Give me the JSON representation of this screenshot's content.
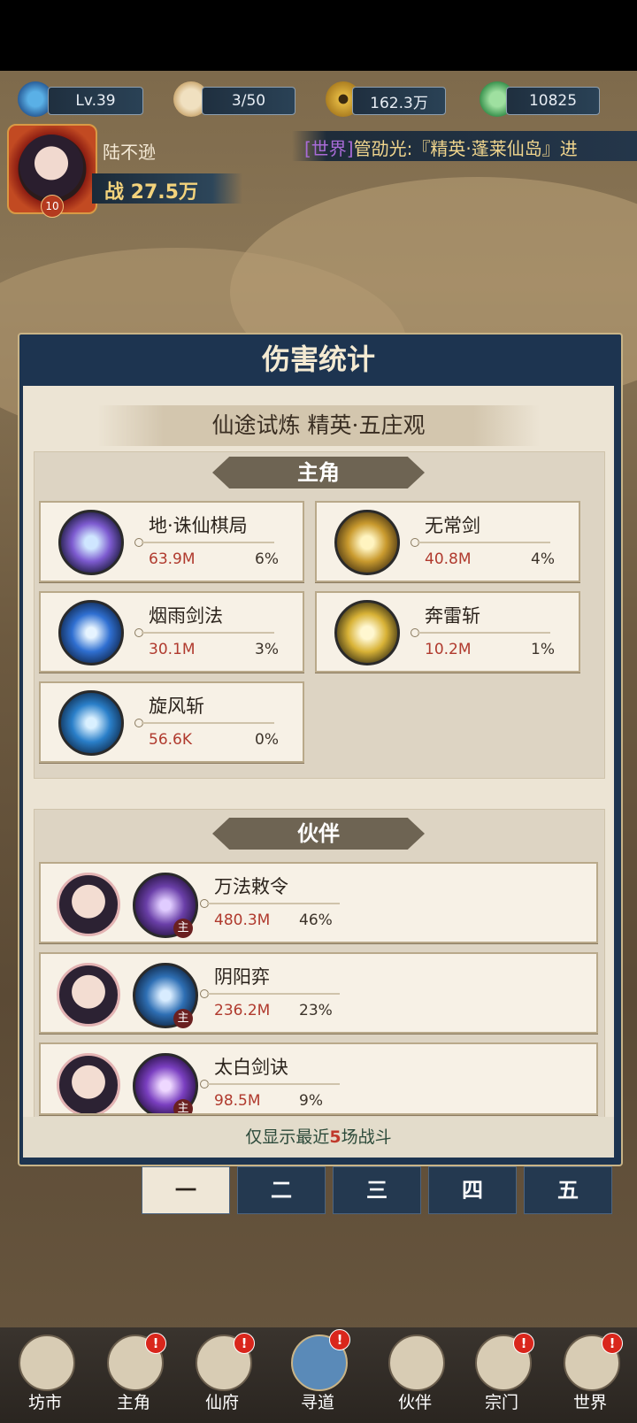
{
  "hud": {
    "level": "Lv.39",
    "stamina": "3/50",
    "coins": "162.3万",
    "jade": "10825",
    "player_name": "陆不逊",
    "power": "战 27.5万",
    "avatar_level": "10",
    "ticker_channel": "[世界]",
    "ticker_text": "管劭光:『精英·蓬莱仙岛』进"
  },
  "panel": {
    "title": "伤害统计",
    "subtitle": "仙途试炼 精英·五庄观",
    "protagonist_section": "主角",
    "partner_section": "伙伴",
    "footer_prefix": "仅显示最近",
    "footer_count": "5",
    "footer_suffix": "场战斗"
  },
  "protagonist_skills": [
    {
      "name": "地·诛仙棋局",
      "damage": "63.9M",
      "percent": "6%",
      "icon": "chess-board-skill-icon",
      "color": "#7d5bd0"
    },
    {
      "name": "无常剑",
      "damage": "40.8M",
      "percent": "4%",
      "icon": "golden-sword-skill-icon",
      "color": "#c99a2e"
    },
    {
      "name": "烟雨剑法",
      "damage": "30.1M",
      "percent": "3%",
      "icon": "rain-sword-skill-icon",
      "color": "#2f6fd1"
    },
    {
      "name": "奔雷斩",
      "damage": "10.2M",
      "percent": "1%",
      "icon": "thunder-slash-skill-icon",
      "color": "#d8b236"
    },
    {
      "name": "旋风斩",
      "damage": "56.6K",
      "percent": "0%",
      "icon": "whirlwind-slash-skill-icon",
      "color": "#2a7fc9"
    }
  ],
  "partners": [
    {
      "skill": "万法敕令",
      "damage": "480.3M",
      "percent": "46%",
      "tag": "主",
      "skill_color": "#6a3fa8"
    },
    {
      "skill": "阴阳弈",
      "damage": "236.2M",
      "percent": "23%",
      "tag": "主",
      "skill_color": "#2e6fb4"
    },
    {
      "skill": "太白剑诀",
      "damage": "98.5M",
      "percent": "9%",
      "tag": "主",
      "skill_color": "#7a3fc0"
    }
  ],
  "tabs": [
    "一",
    "二",
    "三",
    "四",
    "五"
  ],
  "nav": [
    {
      "label": "坊市",
      "badge": ""
    },
    {
      "label": "主角",
      "badge": "!"
    },
    {
      "label": "仙府",
      "badge": "!"
    },
    {
      "label": "寻道",
      "badge": "!"
    },
    {
      "label": "伙伴",
      "badge": ""
    },
    {
      "label": "宗门",
      "badge": "!"
    },
    {
      "label": "世界",
      "badge": "!"
    }
  ]
}
